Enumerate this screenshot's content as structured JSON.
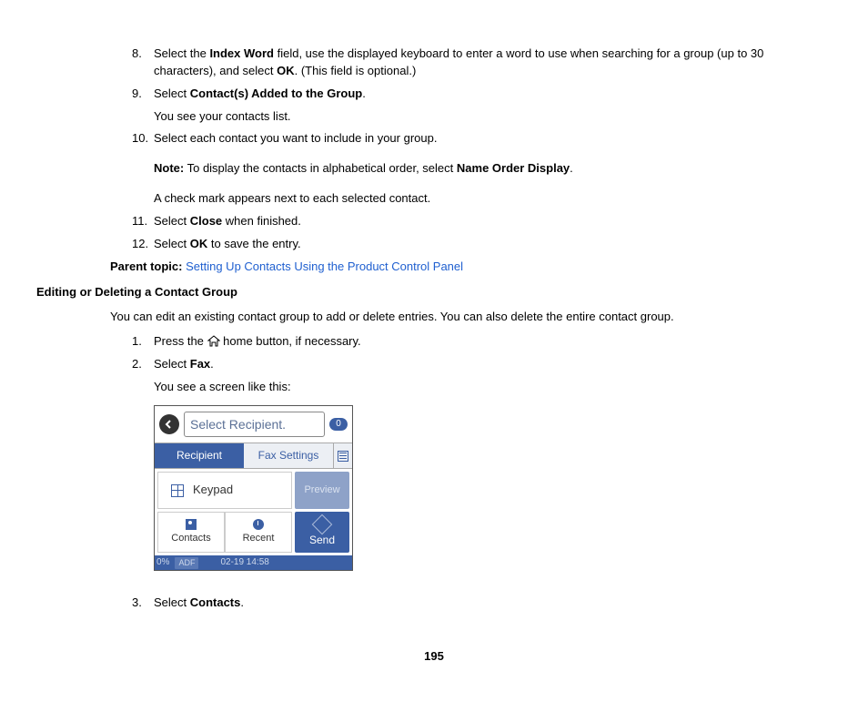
{
  "steps_a": {
    "8": {
      "num": "8.",
      "pre": "Select the ",
      "b1": "Index Word",
      "mid": " field, use the displayed keyboard to enter a word to use when searching for a group (up to 30 characters), and select ",
      "b2": "OK",
      "post": ". (This field is optional.)"
    },
    "9": {
      "num": "9.",
      "pre": "Select ",
      "b1": "Contact(s) Added to the Group",
      "post": ".",
      "sub": "You see your contacts list."
    },
    "10": {
      "num": "10.",
      "text": "Select each contact you want to include in your group.",
      "note_label": "Note:",
      "note_text": " To display the contacts in alphabetical order, select ",
      "note_b": "Name Order Display",
      "note_post": ".",
      "sub2": "A check mark appears next to each selected contact."
    },
    "11": {
      "num": "11.",
      "pre": "Select ",
      "b1": "Close",
      "post": " when finished."
    },
    "12": {
      "num": "12.",
      "pre": "Select ",
      "b1": "OK",
      "post": " to save the entry."
    }
  },
  "parent_topic": {
    "label": "Parent topic:",
    "link": "Setting Up Contacts Using the Product Control Panel"
  },
  "section_heading": "Editing or Deleting a Contact Group",
  "section_intro": "You can edit an existing contact group to add or delete entries. You can also delete the entire contact group.",
  "steps_b": {
    "1": {
      "num": "1.",
      "pre": "Press the ",
      "post": " home button, if necessary."
    },
    "2": {
      "num": "2.",
      "pre": "Select ",
      "b1": "Fax",
      "post": ".",
      "sub": "You see a screen like this:"
    },
    "3": {
      "num": "3.",
      "pre": "Select ",
      "b1": "Contacts",
      "post": "."
    }
  },
  "fax": {
    "recipient_placeholder": "Select Recipient.",
    "badge": "0",
    "tab_recipient": "Recipient",
    "tab_settings": "Fax Settings",
    "keypad": "Keypad",
    "preview": "Preview",
    "contacts": "Contacts",
    "recent": "Recent",
    "send": "Send",
    "percent": "0%",
    "adf": "ADF",
    "datetime": "02-19 14:58"
  },
  "page_number": "195"
}
